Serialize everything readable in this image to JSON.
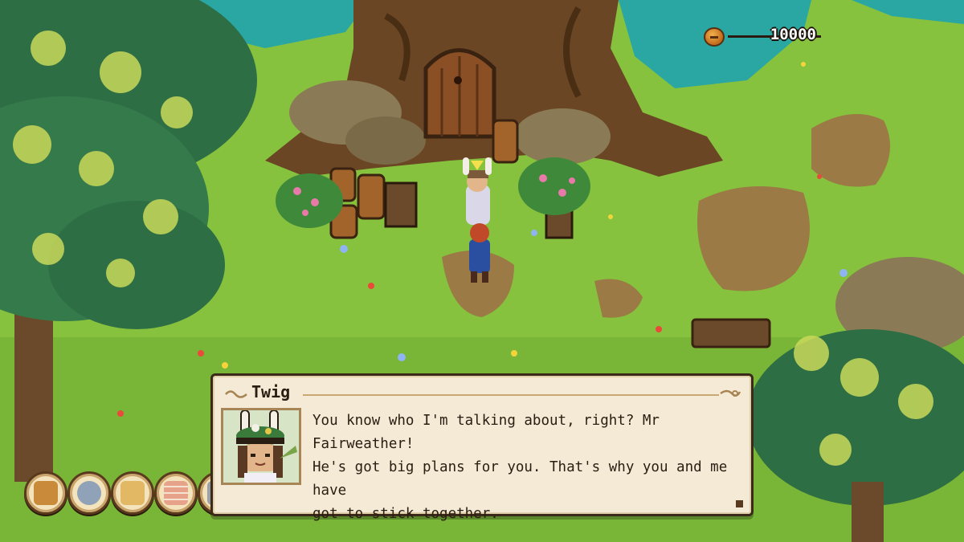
{
  "hud": {
    "currency": {
      "value": "10000",
      "icon": "coin-icon"
    }
  },
  "dialog": {
    "speaker": "Twig",
    "lines": [
      "You know who I'm talking about, right? Mr Fairweather!",
      "He's got big plans for you. That's why you and me have",
      "got to stick together."
    ],
    "advance_icon": "advance-indicator-icon"
  },
  "toolbar": {
    "items": [
      {
        "icon": "character-portrait-icon",
        "color": "#c98b3a"
      },
      {
        "icon": "quest-mask-icon",
        "color": "#8fa2b8"
      },
      {
        "icon": "map-scroll-icon",
        "color": "#e2b865"
      },
      {
        "icon": "calendar-icon",
        "color": "#e7a38a"
      },
      {
        "icon": "more-icon",
        "color": "#9aa0a8"
      }
    ]
  },
  "colors": {
    "grass": "#7fbf3a",
    "dialog_bg": "#f4ead6",
    "dialog_border": "#3b2a1a",
    "water": "#2aa7a3"
  }
}
